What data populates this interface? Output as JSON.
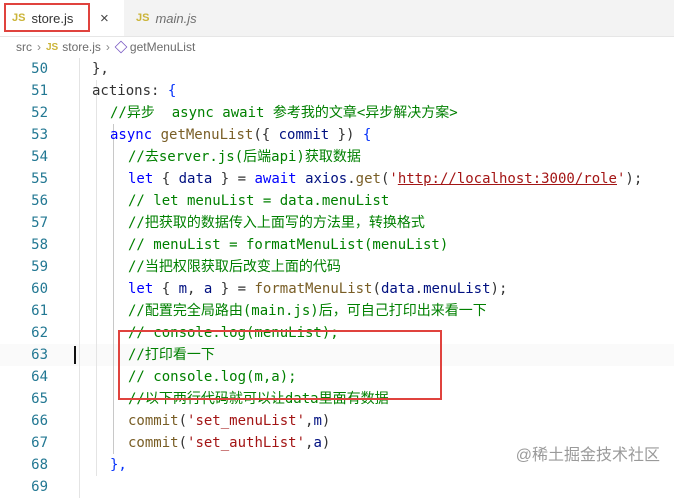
{
  "tabs": [
    {
      "badge": "JS",
      "label": "store.js",
      "close": "×"
    },
    {
      "badge": "JS",
      "label": "main.js"
    }
  ],
  "breadcrumb": {
    "src": "src",
    "sep": "›",
    "badge": "JS",
    "file": "store.js",
    "func": "getMenuList"
  },
  "lines": [
    {
      "n": "50",
      "ind": 2,
      "t": [
        [
          "},",
          "p"
        ]
      ]
    },
    {
      "n": "51",
      "ind": 2,
      "t": [
        [
          "actions: ",
          "p"
        ],
        [
          "{",
          "br"
        ]
      ]
    },
    {
      "n": "52",
      "ind": 3,
      "t": [
        [
          "//异步  async await 参考我的文章<异步解决方案>",
          "cm"
        ]
      ]
    },
    {
      "n": "53",
      "ind": 3,
      "t": [
        [
          "async",
          "kw"
        ],
        [
          " ",
          "p"
        ],
        [
          "getMenuList",
          "fn"
        ],
        [
          "({ ",
          "p"
        ],
        [
          "commit",
          "var"
        ],
        [
          " }) ",
          "p"
        ],
        [
          "{",
          "br"
        ]
      ]
    },
    {
      "n": "54",
      "ind": 4,
      "t": [
        [
          "//去server.js(后端api)获取数据",
          "cm"
        ]
      ]
    },
    {
      "n": "55",
      "ind": 4,
      "t": [
        [
          "let",
          "kw"
        ],
        [
          " { ",
          "p"
        ],
        [
          "data",
          "var"
        ],
        [
          " } = ",
          "p"
        ],
        [
          "await",
          "kw"
        ],
        [
          " ",
          "p"
        ],
        [
          "axios",
          "var"
        ],
        [
          ".",
          "p"
        ],
        [
          "get",
          "fn"
        ],
        [
          "(",
          "p"
        ],
        [
          "'",
          "str"
        ],
        [
          "http://localhost:3000/role",
          "url"
        ],
        [
          "'",
          "str"
        ],
        [
          ");",
          "p"
        ]
      ]
    },
    {
      "n": "56",
      "ind": 4,
      "t": [
        [
          "// let menuList = data.menuList",
          "cm"
        ]
      ]
    },
    {
      "n": "57",
      "ind": 4,
      "t": [
        [
          "//把获取的数据传入上面写的方法里，转换格式",
          "cm"
        ]
      ]
    },
    {
      "n": "58",
      "ind": 4,
      "t": [
        [
          "// menuList = formatMenuList(menuList)",
          "cm"
        ]
      ]
    },
    {
      "n": "59",
      "ind": 4,
      "t": [
        [
          "//当把权限获取后改变上面的代码",
          "cm"
        ]
      ]
    },
    {
      "n": "60",
      "ind": 4,
      "t": [
        [
          "let",
          "kw"
        ],
        [
          " { ",
          "p"
        ],
        [
          "m",
          "var"
        ],
        [
          ", ",
          "p"
        ],
        [
          "a",
          "var"
        ],
        [
          " } = ",
          "p"
        ],
        [
          "formatMenuList",
          "fn"
        ],
        [
          "(",
          "p"
        ],
        [
          "data",
          "var"
        ],
        [
          ".",
          "p"
        ],
        [
          "menuList",
          "var"
        ],
        [
          ");",
          "p"
        ]
      ]
    },
    {
      "n": "61",
      "ind": 4,
      "t": [
        [
          "//配置完全局路由(main.js)后，可自己打印出来看一下",
          "cm"
        ]
      ]
    },
    {
      "n": "62",
      "ind": 4,
      "t": [
        [
          "// console.log(menuList);",
          "cm"
        ]
      ]
    },
    {
      "n": "63",
      "ind": 4,
      "t": [
        [
          "//打印看一下",
          "cm"
        ]
      ]
    },
    {
      "n": "64",
      "ind": 4,
      "t": [
        [
          "// console.log(m,a);",
          "cm"
        ]
      ]
    },
    {
      "n": "65",
      "ind": 4,
      "t": [
        [
          "//以下两行代码就可以让data里面有数据",
          "cm"
        ]
      ]
    },
    {
      "n": "66",
      "ind": 4,
      "t": [
        [
          "commit",
          "fn"
        ],
        [
          "(",
          "p"
        ],
        [
          "'set_menuList'",
          "str"
        ],
        [
          ",",
          "p"
        ],
        [
          "m",
          "var"
        ],
        [
          ")",
          "p"
        ]
      ]
    },
    {
      "n": "67",
      "ind": 4,
      "t": [
        [
          "commit",
          "fn"
        ],
        [
          "(",
          "p"
        ],
        [
          "'set_authList'",
          "str"
        ],
        [
          ",",
          "p"
        ],
        [
          "a",
          "var"
        ],
        [
          ")",
          "p"
        ]
      ]
    },
    {
      "n": "68",
      "ind": 3,
      "t": [
        [
          "},",
          "br"
        ]
      ]
    },
    {
      "n": "69",
      "ind": 2,
      "t": [
        [
          "",
          "p"
        ]
      ]
    }
  ],
  "active_line": "63",
  "watermark": "@稀土掘金技术社区"
}
